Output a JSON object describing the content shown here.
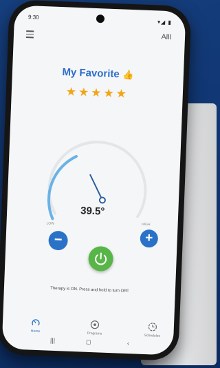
{
  "status": {
    "time": "9:30",
    "icons": "▾◢ ▮"
  },
  "header": {
    "profile_label": "AIII"
  },
  "favorite": {
    "title": "My Favorite",
    "rating": 5,
    "stars": "★★★★★",
    "thumb": "👍"
  },
  "dial": {
    "temperature": "39.5°",
    "low_label": "LOW",
    "high_label": "HIGH",
    "level": 0.35
  },
  "controls": {
    "minus": "−",
    "plus": "+"
  },
  "status_message": "Therapy is ON. Press and hold to turn OFF",
  "tabs": [
    {
      "label": "Home",
      "icon": "dial-icon"
    },
    {
      "label": "Programs",
      "icon": "programs-icon"
    },
    {
      "label": "Schedules",
      "icon": "schedule-icon"
    }
  ],
  "system_nav": {
    "recents": "|||",
    "home": "◻",
    "back": "‹"
  },
  "colors": {
    "accent": "#2a72c7",
    "star": "#f2a516",
    "power": "#58b548",
    "background": "#0f3470"
  }
}
